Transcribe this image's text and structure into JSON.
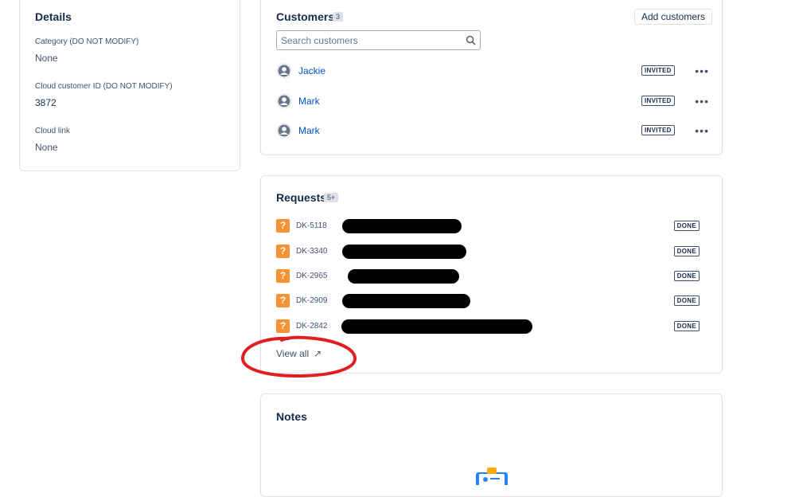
{
  "details": {
    "title": "Details",
    "fields": [
      {
        "label": "Category (DO NOT MODIFY)",
        "value": "None"
      },
      {
        "label": "Cloud customer ID (DO NOT MODIFY)",
        "value": "3872"
      },
      {
        "label": "Cloud link",
        "value": "None"
      }
    ]
  },
  "customers": {
    "title": "Customers",
    "count": "3",
    "add_label": "Add customers",
    "search_placeholder": "Search customers",
    "items": [
      {
        "name": "Jackie",
        "status": "INVITED"
      },
      {
        "name": "Mark",
        "status": "INVITED"
      },
      {
        "name": "Mark",
        "status": "INVITED"
      }
    ],
    "more_icon": "more-horizontal-icon"
  },
  "requests": {
    "title": "Requests",
    "count": "5+",
    "items": [
      {
        "key": "DK-5118",
        "status": "DONE"
      },
      {
        "key": "DK-3340",
        "status": "DONE"
      },
      {
        "key": "DK-2965",
        "status": "DONE"
      },
      {
        "key": "DK-2909",
        "status": "DONE"
      },
      {
        "key": "DK-2842",
        "status": "DONE"
      }
    ],
    "view_all": "View all"
  },
  "notes": {
    "title": "Notes"
  },
  "colors": {
    "accent_link": "#0052cc",
    "question_icon": "#f79232",
    "annotation_circle": "#e02020"
  }
}
